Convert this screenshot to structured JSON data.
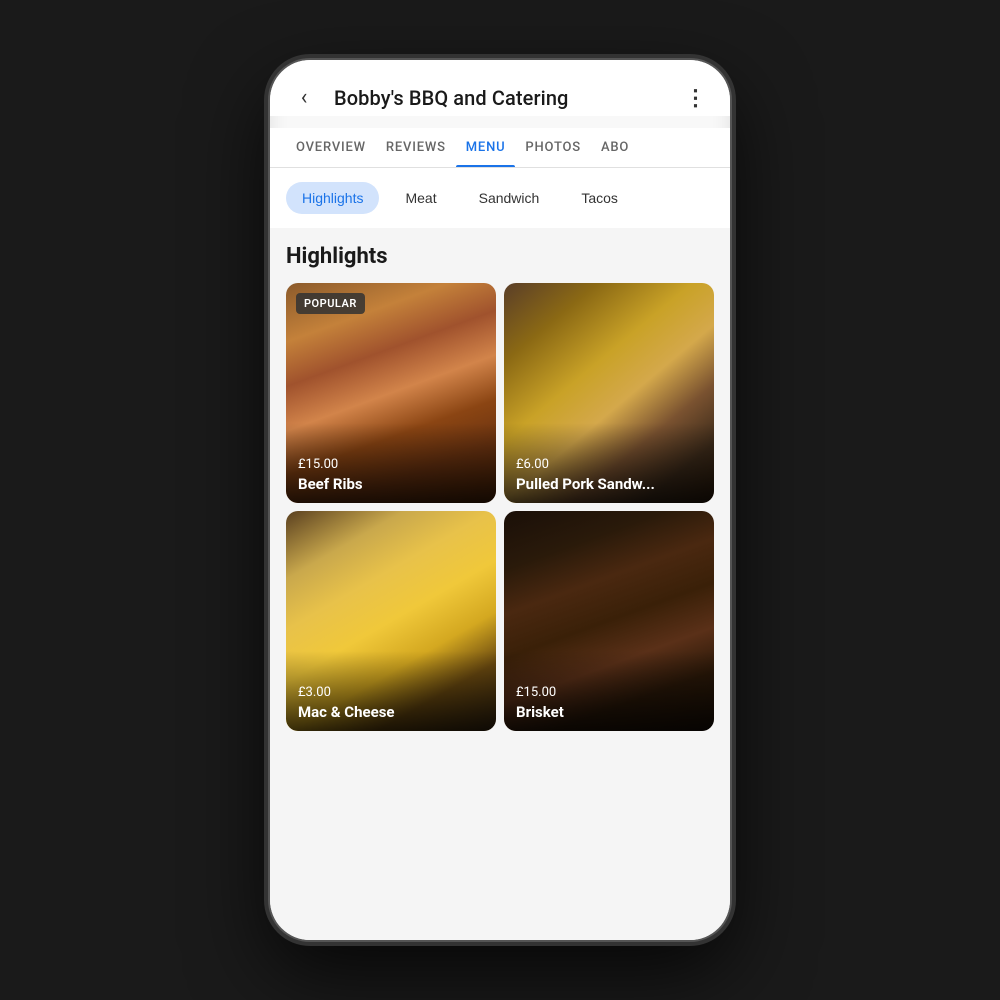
{
  "header": {
    "title": "Bobby's BBQ and Catering",
    "back_label": "‹",
    "more_label": "⋮"
  },
  "nav": {
    "tabs": [
      {
        "id": "overview",
        "label": "OVERVIEW",
        "active": false
      },
      {
        "id": "reviews",
        "label": "REVIEWS",
        "active": false
      },
      {
        "id": "menu",
        "label": "MENU",
        "active": true
      },
      {
        "id": "photos",
        "label": "PHOTOS",
        "active": false
      },
      {
        "id": "about",
        "label": "ABO",
        "active": false
      }
    ]
  },
  "categories": {
    "pills": [
      {
        "id": "highlights",
        "label": "Highlights",
        "active": true
      },
      {
        "id": "meat",
        "label": "Meat",
        "active": false
      },
      {
        "id": "sandwich",
        "label": "Sandwich",
        "active": false
      },
      {
        "id": "tacos",
        "label": "Tacos",
        "active": false
      }
    ]
  },
  "section": {
    "title": "Highlights",
    "items": [
      {
        "id": "beef-ribs",
        "name": "Beef Ribs",
        "price": "£15.00",
        "popular": true,
        "popular_label": "POPULAR",
        "image_class": "img-beef-ribs"
      },
      {
        "id": "pulled-pork",
        "name": "Pulled Pork Sandw...",
        "price": "£6.00",
        "popular": false,
        "image_class": "img-pulled-pork"
      },
      {
        "id": "mac-cheese",
        "name": "Mac & Cheese",
        "price": "£3.00",
        "popular": false,
        "image_class": "img-mac-cheese"
      },
      {
        "id": "brisket",
        "name": "Brisket",
        "price": "£15.00",
        "popular": false,
        "image_class": "img-brisket"
      }
    ]
  }
}
